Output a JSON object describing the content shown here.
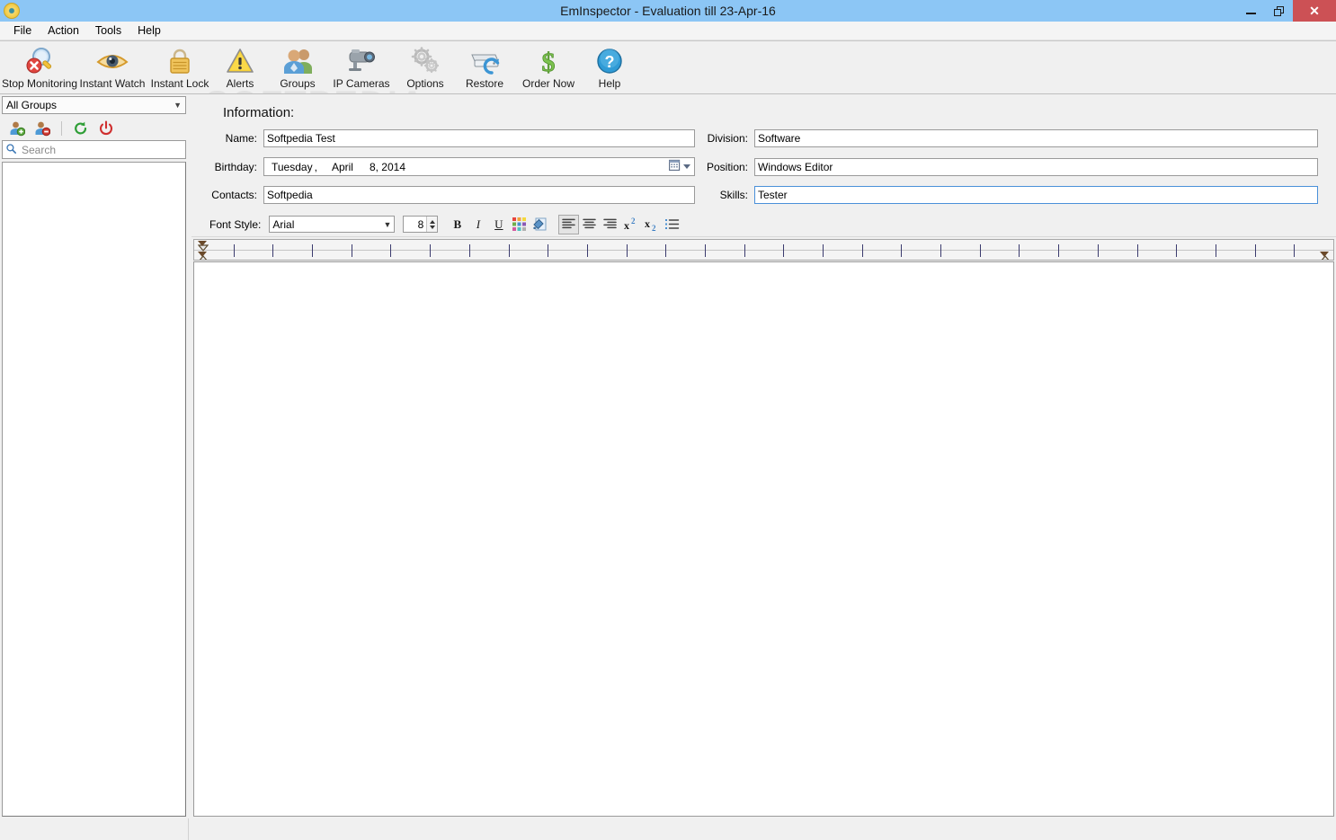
{
  "window": {
    "title": "EmInspector - Evaluation till 23-Apr-16",
    "app_icon": "eye-app-icon",
    "minimize_label": "Minimize",
    "restore_label": "Restore",
    "close_label": "Close",
    "accent_titlebar": "#8cc6f5",
    "accent_close": "#cc5155"
  },
  "menubar": {
    "items": [
      {
        "label": "File"
      },
      {
        "label": "Action"
      },
      {
        "label": "Tools"
      },
      {
        "label": "Help"
      }
    ]
  },
  "toolbar": {
    "watermark": "SOFTPEDIA",
    "watermark_mark": "®",
    "buttons": [
      {
        "label": "Stop Monitoring",
        "icon": "magnifier-stop-icon"
      },
      {
        "label": "Instant Watch",
        "icon": "eye-icon"
      },
      {
        "label": "Instant Lock",
        "icon": "padlock-icon"
      },
      {
        "label": "Alerts",
        "icon": "warning-triangle-icon"
      },
      {
        "label": "Groups",
        "icon": "users-group-icon"
      },
      {
        "label": "IP Cameras",
        "icon": "cctv-camera-icon"
      },
      {
        "label": "Options",
        "icon": "gears-icon"
      },
      {
        "label": "Restore",
        "icon": "restore-drive-icon"
      },
      {
        "label": "Order Now",
        "icon": "dollar-sign-icon"
      },
      {
        "label": "Help",
        "icon": "help-question-icon"
      }
    ]
  },
  "sidebar": {
    "group_filter": {
      "value": "All Groups",
      "caret": "chevron-down-icon"
    },
    "tools": [
      {
        "name": "add-user-icon",
        "title": "Add User"
      },
      {
        "name": "remove-user-icon",
        "title": "Remove User"
      },
      {
        "name": "refresh-icon",
        "title": "Refresh"
      },
      {
        "name": "power-icon",
        "title": "Power"
      }
    ],
    "search": {
      "placeholder": "Search",
      "value": "",
      "icon": "search-icon"
    },
    "user_list": {
      "items": []
    }
  },
  "main": {
    "section_title": "Information:",
    "fields": {
      "name": {
        "label": "Name:",
        "value": "Softpedia Test",
        "focused": false
      },
      "birthday": {
        "label": "Birthday:",
        "weekday": "Tuesday",
        "comma": ",",
        "month": "April",
        "day_year": "8, 2014",
        "picker_icon": "calendar-icon"
      },
      "contacts": {
        "label": "Contacts:",
        "value": "Softpedia",
        "focused": false
      },
      "division": {
        "label": "Division:",
        "value": "Software",
        "focused": false
      },
      "position": {
        "label": "Position:",
        "value": "Windows Editor",
        "focused": false
      },
      "skills": {
        "label": "Skills:",
        "value": "Tester",
        "focused": true
      }
    },
    "font_toolbar": {
      "label": "Font Style:",
      "font_family": {
        "value": "Arial",
        "caret": "chevron-down-icon"
      },
      "font_size": {
        "value": "8"
      },
      "buttons": [
        {
          "name": "bold-button",
          "glyph": "B",
          "pressed": false
        },
        {
          "name": "italic-button",
          "glyph": "I",
          "pressed": false
        },
        {
          "name": "underline-button",
          "glyph": "U",
          "pressed": false
        },
        {
          "name": "font-color-button",
          "glyph": "palette-icon",
          "pressed": false
        },
        {
          "name": "highlight-color-button",
          "glyph": "paint-bucket-icon",
          "pressed": false
        },
        {
          "name": "align-left-button",
          "glyph": "align-left-icon",
          "pressed": true
        },
        {
          "name": "align-center-button",
          "glyph": "align-center-icon",
          "pressed": false
        },
        {
          "name": "align-right-button",
          "glyph": "align-right-icon",
          "pressed": false
        },
        {
          "name": "superscript-button",
          "glyph": "x2-sup",
          "pressed": false
        },
        {
          "name": "subscript-button",
          "glyph": "x2-sub",
          "pressed": false
        },
        {
          "name": "bullet-list-button",
          "glyph": "bullet-list-icon",
          "pressed": false
        }
      ]
    },
    "ruler": {
      "tick_count": 28,
      "left_indent": "indent-marker",
      "right_indent": "indent-marker"
    },
    "editor": {
      "content": ""
    }
  }
}
